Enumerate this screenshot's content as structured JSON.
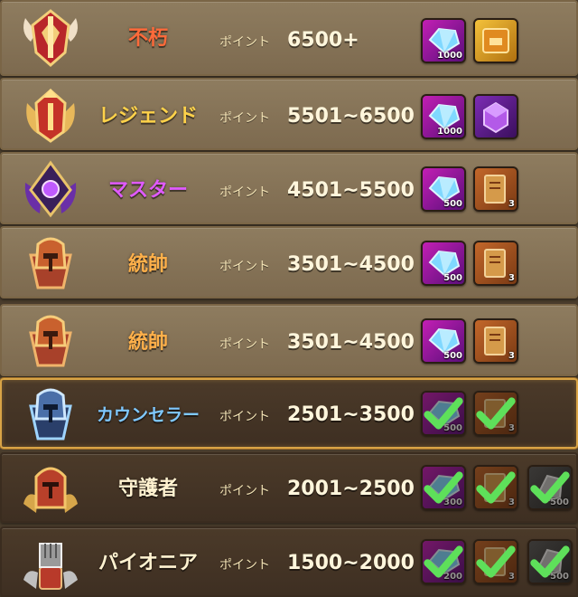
{
  "colors": {
    "immortal": "#ff6a3a",
    "legend": "#ffd24a",
    "master": "#e05aff",
    "commander": "#ffb04a",
    "counselor": "#7fc8ff",
    "guardian": "#fff2d0",
    "pioneer": "#fff2d0"
  },
  "rows": [
    {
      "tier": "不朽",
      "points_label": "ポイント",
      "points": "6500+",
      "rewards": [
        {
          "icon": "diamond-icon",
          "qty": "1000"
        },
        {
          "icon": "gold-chest-icon",
          "qty": ""
        }
      ]
    },
    {
      "tier": "レジェンド",
      "points_label": "ポイント",
      "points": "5501~6500",
      "rewards": [
        {
          "icon": "diamond-icon",
          "qty": "1000"
        },
        {
          "icon": "purple-box-icon",
          "qty": ""
        }
      ]
    },
    {
      "tier": "マスター",
      "points_label": "ポイント",
      "points": "4501~5500",
      "rewards": [
        {
          "icon": "diamond-icon",
          "qty": "500"
        },
        {
          "icon": "scroll-icon",
          "qty": "3"
        }
      ]
    },
    {
      "tier": "統帥",
      "points_label": "ポイント",
      "points": "3501~4500",
      "rewards": [
        {
          "icon": "diamond-icon",
          "qty": "500"
        },
        {
          "icon": "scroll-icon",
          "qty": "3"
        }
      ]
    },
    {
      "tier": "統帥",
      "points_label": "ポイント",
      "points": "3501~4500",
      "rewards": [
        {
          "icon": "diamond-icon",
          "qty": "500"
        },
        {
          "icon": "scroll-icon",
          "qty": "3"
        }
      ]
    },
    {
      "tier": "カウンセラー",
      "points_label": "ポイント",
      "points": "2501~3500",
      "rewards": [
        {
          "icon": "diamond-icon",
          "qty": "500"
        },
        {
          "icon": "scroll-icon",
          "qty": "3"
        }
      ]
    },
    {
      "tier": "守護者",
      "points_label": "ポイント",
      "points": "2001~2500",
      "rewards": [
        {
          "icon": "diamond-icon",
          "qty": "300"
        },
        {
          "icon": "scroll-icon",
          "qty": "3"
        },
        {
          "icon": "shard-icon",
          "qty": "500"
        }
      ]
    },
    {
      "tier": "パイオニア",
      "points_label": "ポイント",
      "points": "1500~2000",
      "rewards": [
        {
          "icon": "diamond-icon",
          "qty": "200"
        },
        {
          "icon": "scroll-icon",
          "qty": "3"
        },
        {
          "icon": "shard-icon",
          "qty": "500"
        }
      ]
    }
  ]
}
